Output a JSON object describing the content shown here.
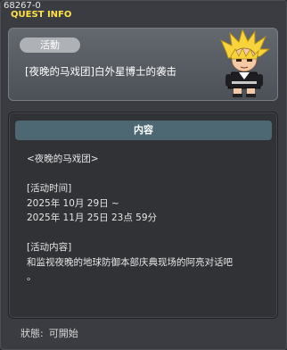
{
  "window": {
    "id_text": "68267-0",
    "title": "QUEST INFO"
  },
  "quest": {
    "category": "活動",
    "name": "[夜晚的马戏团]白外星博士的袭击",
    "portrait_icon": "npc-portrait-icon"
  },
  "content": {
    "header": "内容",
    "lines": [
      "<夜晚的马戏团>",
      "",
      "[活动时间]",
      "2025年 10月 29日 ~",
      "2025年 11月 25日 23点 59分",
      "",
      "[活动内容]",
      "和监视夜晚的地球防御本部庆典现场的阿亮对话吧",
      "。"
    ]
  },
  "status": {
    "label": "狀態:",
    "value": "可開始"
  },
  "colors": {
    "title": "#ffe24a",
    "header_bg": "#4d6873",
    "panel_bg": "#303236"
  }
}
